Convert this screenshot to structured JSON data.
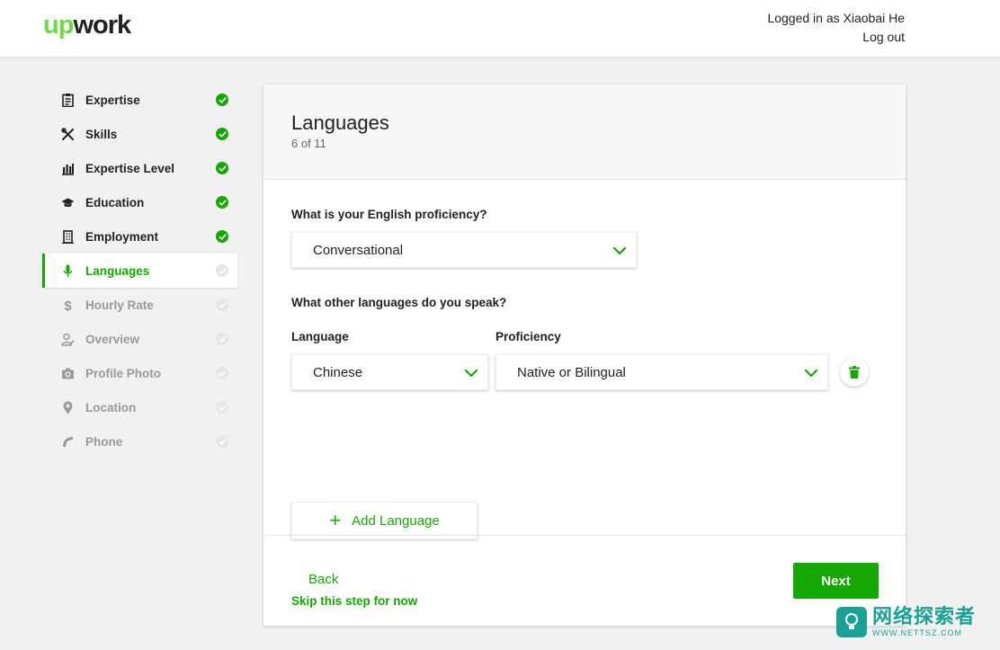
{
  "header": {
    "logo_up": "up",
    "logo_work": "work",
    "logged_in_text": "Logged in as Xiaobai He",
    "logout_label": "Log out"
  },
  "colors": {
    "accent": "#14a800",
    "brand_light": "#6fda44",
    "pending": "#9a9a9a"
  },
  "sidebar": {
    "items": [
      {
        "label": "Expertise",
        "icon": "clipboard-icon",
        "status": "done"
      },
      {
        "label": "Skills",
        "icon": "tools-icon",
        "status": "done"
      },
      {
        "label": "Expertise Level",
        "icon": "bar-chart-icon",
        "status": "done"
      },
      {
        "label": "Education",
        "icon": "graduation-cap-icon",
        "status": "done"
      },
      {
        "label": "Employment",
        "icon": "building-icon",
        "status": "done"
      },
      {
        "label": "Languages",
        "icon": "microphone-icon",
        "status": "active"
      },
      {
        "label": "Hourly Rate",
        "icon": "dollar-icon",
        "status": "pending"
      },
      {
        "label": "Overview",
        "icon": "user-edit-icon",
        "status": "pending"
      },
      {
        "label": "Profile Photo",
        "icon": "camera-icon",
        "status": "pending"
      },
      {
        "label": "Location",
        "icon": "map-pin-icon",
        "status": "pending"
      },
      {
        "label": "Phone",
        "icon": "phone-icon",
        "status": "pending"
      }
    ]
  },
  "card": {
    "title": "Languages",
    "step": "6 of 11",
    "english_question": "What is your English proficiency?",
    "english_value": "Conversational",
    "other_question": "What other languages do you speak?",
    "language_col": "Language",
    "proficiency_col": "Proficiency",
    "language_value": "Chinese",
    "proficiency_value": "Native or Bilingual",
    "add_language_label": "Add Language",
    "skip_label": "Skip this step for now",
    "back_label": "Back",
    "next_label": "Next"
  },
  "watermark": {
    "cn": "网络探索者",
    "en": "WWW.NETTSZ.COM"
  }
}
